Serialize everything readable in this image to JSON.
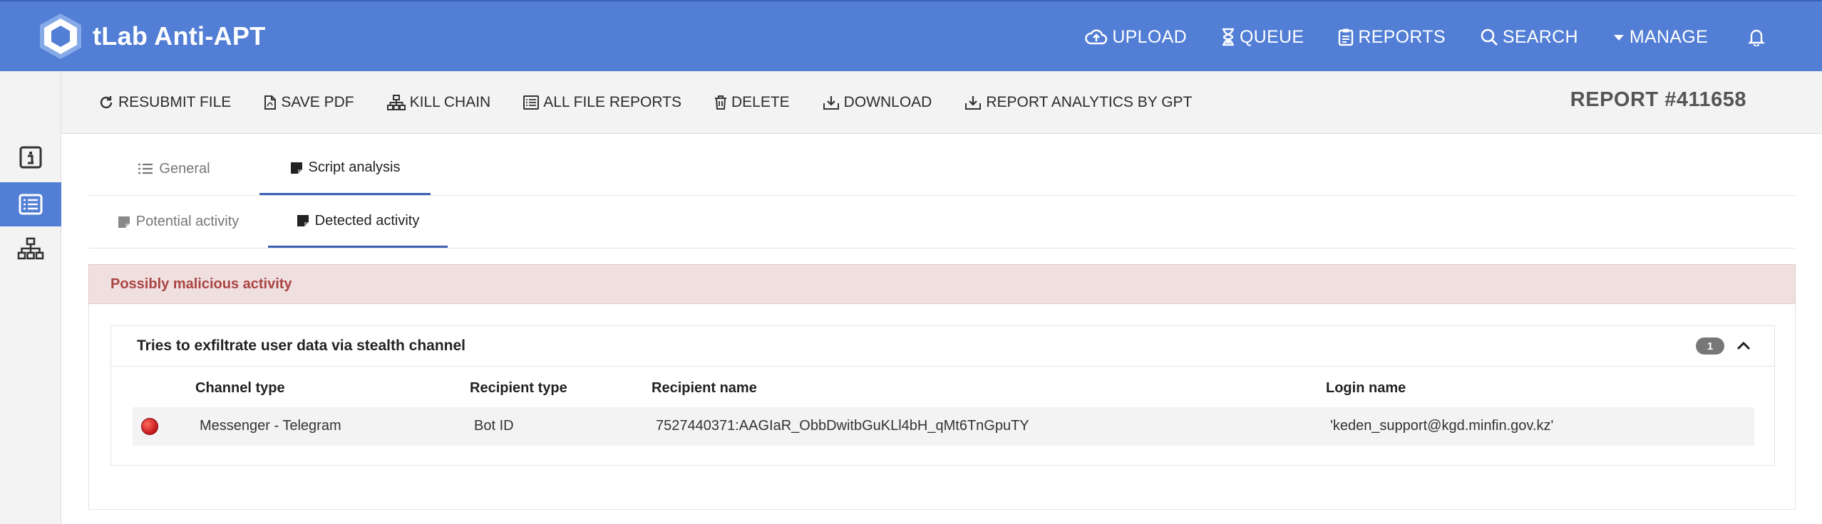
{
  "app": {
    "name": "tLab Anti-APT"
  },
  "topnav": [
    {
      "label": "UPLOAD",
      "icon": "cloud-upload-icon"
    },
    {
      "label": "QUEUE",
      "icon": "hourglass-icon"
    },
    {
      "label": "REPORTS",
      "icon": "clipboard-icon"
    },
    {
      "label": "SEARCH",
      "icon": "search-icon"
    },
    {
      "label": "MANAGE",
      "icon": "caret-down-icon"
    }
  ],
  "toolbar": [
    {
      "label": "RESUBMIT FILE",
      "icon": "redo-icon"
    },
    {
      "label": "SAVE PDF",
      "icon": "pdf-file-icon"
    },
    {
      "label": "KILL CHAIN",
      "icon": "hierarchy-icon"
    },
    {
      "label": "ALL FILE REPORTS",
      "icon": "list-icon"
    },
    {
      "label": "DELETE",
      "icon": "trash-icon"
    },
    {
      "label": "DOWNLOAD",
      "icon": "download-icon"
    },
    {
      "label": "REPORT ANALYTICS BY GPT",
      "icon": "download-icon"
    }
  ],
  "report": {
    "title": "REPORT #411658"
  },
  "tabs": [
    {
      "label": "General"
    },
    {
      "label": "Script analysis"
    }
  ],
  "subtabs": [
    {
      "label": "Potential activity"
    },
    {
      "label": "Detected activity"
    }
  ],
  "alert": {
    "text": "Possibly malicious activity"
  },
  "finding": {
    "title": "Tries to exfiltrate user data via stealth channel",
    "count": "1",
    "columns": [
      "Channel type",
      "Recipient type",
      "Recipient name",
      "Login name"
    ],
    "rows": [
      {
        "channel_type": "Messenger - Telegram",
        "recipient_type": "Bot ID",
        "recipient_name": "7527440371:AAGIaR_ObbDwitbGuKLl4bH_qMt6TnGpuTY",
        "login_name": "'keden_support@kgd.minfin.gov.kz'"
      }
    ]
  },
  "colors": {
    "brand": "#527ed5",
    "alert_bg": "#f0dfdf",
    "alert_text": "#a94442"
  }
}
